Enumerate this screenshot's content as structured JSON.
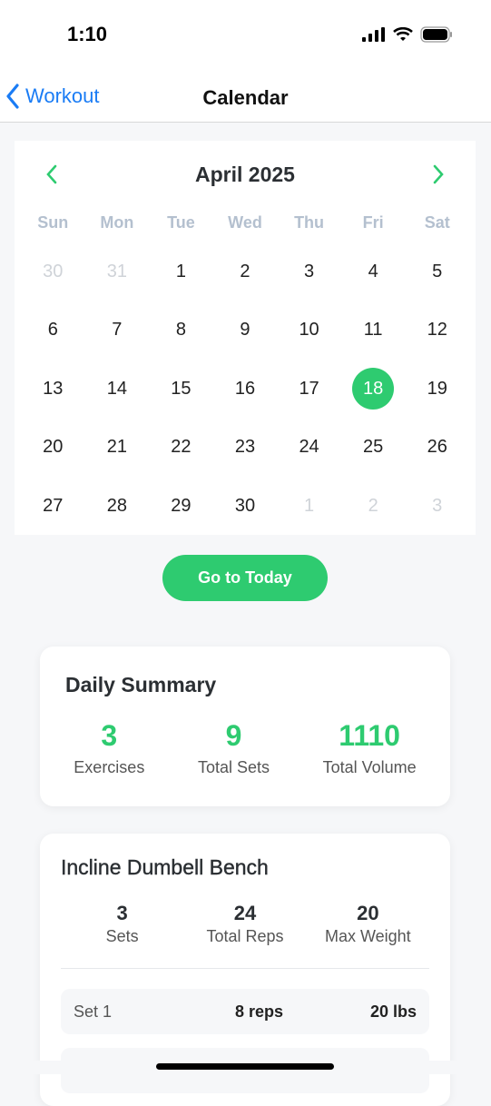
{
  "status": {
    "time": "1:10"
  },
  "nav": {
    "back_label": "Workout",
    "title": "Calendar"
  },
  "calendar": {
    "month_label": "April 2025",
    "weekdays": [
      "Sun",
      "Mon",
      "Tue",
      "Wed",
      "Thu",
      "Fri",
      "Sat"
    ],
    "days": [
      {
        "d": "30",
        "m": true
      },
      {
        "d": "31",
        "m": true
      },
      {
        "d": "1"
      },
      {
        "d": "2"
      },
      {
        "d": "3"
      },
      {
        "d": "4"
      },
      {
        "d": "5"
      },
      {
        "d": "6"
      },
      {
        "d": "7"
      },
      {
        "d": "8"
      },
      {
        "d": "9"
      },
      {
        "d": "10"
      },
      {
        "d": "11"
      },
      {
        "d": "12"
      },
      {
        "d": "13"
      },
      {
        "d": "14"
      },
      {
        "d": "15"
      },
      {
        "d": "16"
      },
      {
        "d": "17"
      },
      {
        "d": "18",
        "s": true
      },
      {
        "d": "19"
      },
      {
        "d": "20"
      },
      {
        "d": "21"
      },
      {
        "d": "22"
      },
      {
        "d": "23"
      },
      {
        "d": "24"
      },
      {
        "d": "25"
      },
      {
        "d": "26"
      },
      {
        "d": "27"
      },
      {
        "d": "28"
      },
      {
        "d": "29"
      },
      {
        "d": "30"
      },
      {
        "d": "1",
        "m": true
      },
      {
        "d": "2",
        "m": true
      },
      {
        "d": "3",
        "m": true
      }
    ],
    "today_button": "Go to Today",
    "accent": "#2ecb70"
  },
  "summary": {
    "title": "Daily Summary",
    "stats": [
      {
        "value": "3",
        "label": "Exercises"
      },
      {
        "value": "9",
        "label": "Total Sets"
      },
      {
        "value": "1110",
        "label": "Total Volume"
      }
    ]
  },
  "exercise": {
    "title": "Incline Dumbell Bench",
    "stats": [
      {
        "value": "3",
        "label": "Sets"
      },
      {
        "value": "24",
        "label": "Total Reps"
      },
      {
        "value": "20",
        "label": "Max Weight"
      }
    ],
    "sets": [
      {
        "label": "Set 1",
        "reps": "8 reps",
        "weight": "20 lbs"
      }
    ]
  }
}
